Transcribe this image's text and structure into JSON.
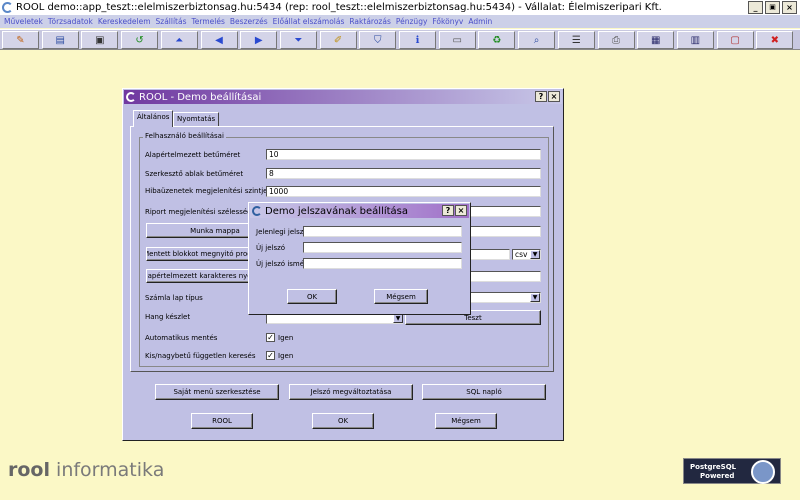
{
  "window": {
    "title": "ROOL demo::app_teszt::elelmiszerbiztonsag.hu:5434 (rep: rool_teszt::elelmiszerbiztonsag.hu:5434) - Vállalat: Élelmiszeripari Kft.",
    "minimize": "_",
    "restore": "́",
    "close": "×"
  },
  "menu": [
    "Műveletek",
    "Törzsadatok",
    "Kereskedelem",
    "Szállítás",
    "Termelés",
    "Beszerzés",
    "Előállat elszámolás",
    "Raktározás",
    "Pénzügy",
    "Főkönyv",
    "Admin"
  ],
  "toolbar_icons": [
    {
      "name": "pencil-tool",
      "glyph": "✎",
      "color": "#c06010"
    },
    {
      "name": "open",
      "glyph": "▤",
      "color": "#2a4aa0"
    },
    {
      "name": "save",
      "glyph": "▣",
      "color": "#333333"
    },
    {
      "name": "refresh-green",
      "glyph": "↺",
      "color": "#1a8a1a"
    },
    {
      "name": "first-record",
      "glyph": "⏶",
      "color": "#2a4ad0"
    },
    {
      "name": "previous",
      "glyph": "◀",
      "color": "#2a4ad0"
    },
    {
      "name": "next",
      "glyph": "▶",
      "color": "#2a4ad0"
    },
    {
      "name": "last-record",
      "glyph": "⏷",
      "color": "#2a4ad0"
    },
    {
      "name": "edit-pen",
      "glyph": "✐",
      "color": "#c09010"
    },
    {
      "name": "shield",
      "glyph": "⛉",
      "color": "#2a4aa0"
    },
    {
      "name": "info",
      "glyph": "ℹ",
      "color": "#2a4ad0"
    },
    {
      "name": "window",
      "glyph": "▭",
      "color": "#555555"
    },
    {
      "name": "recycle",
      "glyph": "♻",
      "color": "#1a8a1a"
    },
    {
      "name": "search",
      "glyph": "⌕",
      "color": "#2a4aa0"
    },
    {
      "name": "list",
      "glyph": "☰",
      "color": "#333333"
    },
    {
      "name": "printer",
      "glyph": "⎙",
      "color": "#555555"
    },
    {
      "name": "grid",
      "glyph": "▦",
      "color": "#2a2a6a"
    },
    {
      "name": "table",
      "glyph": "▥",
      "color": "#2a2a6a"
    },
    {
      "name": "calendar",
      "glyph": "▢",
      "color": "#b03030"
    },
    {
      "name": "exit",
      "glyph": "✖",
      "color": "#d02020"
    }
  ],
  "settings_dialog": {
    "title": "ROOL - Demo beállításai",
    "help": "?",
    "close": "×",
    "tabs": [
      "Általános",
      "Nyomtatás"
    ],
    "group_label": "Felhasználó beállításai",
    "labels": {
      "default_font_size": "Alapértelmezett betűméret",
      "editor_font_size": "Szerkesztő ablak betűméret",
      "error_level": "Hibaüzenetek megjelenítési szintje",
      "report_width": "Riport megjelenítési szélessége",
      "invoice_type": "Számla lap típus",
      "sound_set": "Hang készlet",
      "autosave": "Automatikus mentés",
      "case_search": "Kis/nagybetű független keresés"
    },
    "values": {
      "default_font_size": "10",
      "editor_font_size": "8",
      "error_level": "1000",
      "csv": "csv",
      "autosave": "Igen",
      "case_search": "Igen"
    },
    "buttons": {
      "work_folder": "Munka mappa",
      "notepad_program": "Mentett blokkot megnyitó progra",
      "default_charset": "Alapértelmezett karakteres nyomt",
      "test": "Teszt",
      "own_menu_editor": "Saját menü szerkesztése",
      "change_password": "Jelszó megváltoztatása",
      "sql_log": "SQL napló",
      "rool": "ROOL",
      "ok": "OK",
      "cancel": "Mégsem"
    }
  },
  "password_dialog": {
    "title": "Demo jelszavának beállítása",
    "help": "?",
    "close": "×",
    "labels": {
      "current": "Jelenlegi jelszó",
      "new": "Új jelszó",
      "confirm": "Új jelszó ismét"
    },
    "buttons": {
      "ok": "OK",
      "cancel": "Mégsem"
    }
  },
  "branding": {
    "logo_text": "rool",
    "company": "informatika",
    "badge_line1": "PostgreSQL",
    "badge_line2": "Powered"
  },
  "colors": {
    "desktop": "#fbf8c6",
    "dialog_bg": "#c0c0e4",
    "title_gradient_from": "#7038a0",
    "title_gradient_to": "#c8c8e8",
    "menu_text": "#4a4fc8"
  }
}
